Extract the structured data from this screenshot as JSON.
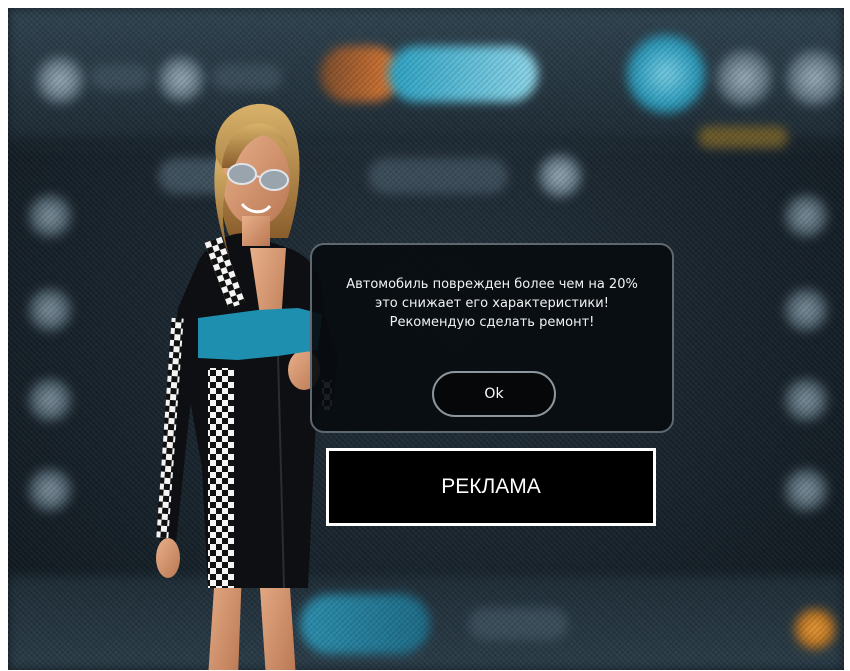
{
  "dialog": {
    "message_lines": [
      "Автомобиль поврежден более чем на 20%",
      "это снижает его характеристики!",
      "Рекомендую сделать ремонт!"
    ],
    "ok_label": "Ok"
  },
  "ad": {
    "label": "РЕКЛАМА"
  },
  "colors": {
    "accent_cyan": "#1e8fae",
    "accent_orange": "#d8712c",
    "dialog_bg": "#080c10",
    "dialog_border": "#5d6870"
  }
}
